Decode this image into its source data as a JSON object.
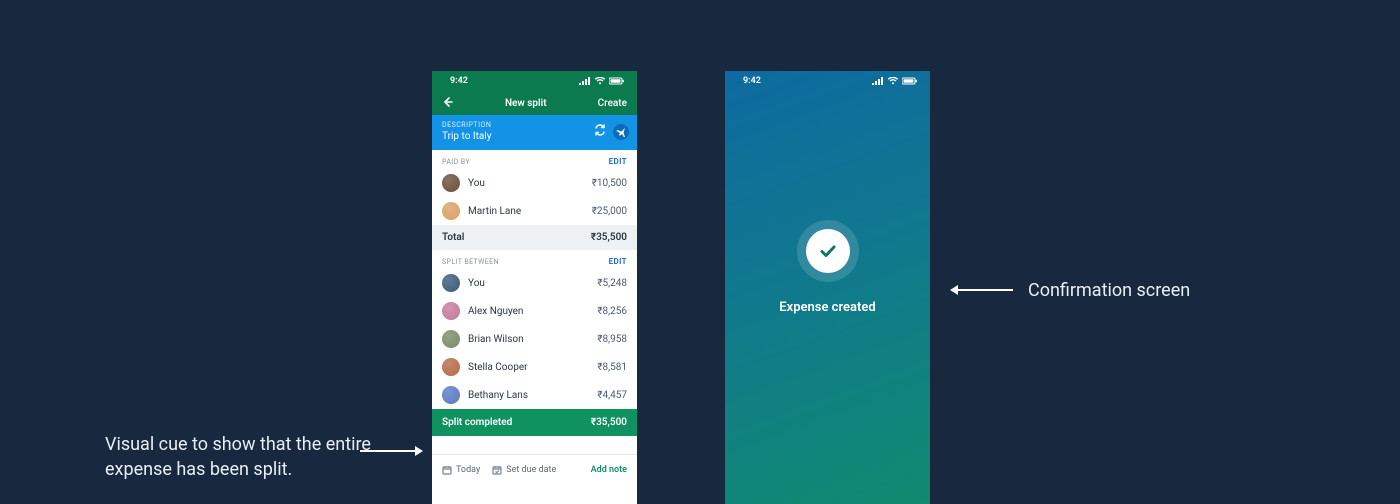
{
  "annotations": {
    "left": "Visual cue to show that the entire expense has been split.",
    "right": "Confirmation screen"
  },
  "status": {
    "time": "9:42"
  },
  "nav": {
    "title": "New split",
    "action": "Create"
  },
  "description": {
    "label": "DESCRIPTION",
    "value": "Trip to Italy"
  },
  "paid_by": {
    "label": "PAID BY",
    "edit": "EDIT",
    "rows": [
      {
        "name": "You",
        "amount": "₹10,500"
      },
      {
        "name": "Martin Lane",
        "amount": "₹25,000"
      }
    ],
    "total_label": "Total",
    "total_amount": "₹35,500"
  },
  "split_between": {
    "label": "SPLIT BETWEEN",
    "edit": "EDIT",
    "rows": [
      {
        "name": "You",
        "amount": "₹5,248"
      },
      {
        "name": "Alex Nguyen",
        "amount": "₹8,256"
      },
      {
        "name": "Brian Wilson",
        "amount": "₹8,958"
      },
      {
        "name": "Stella Cooper",
        "amount": "₹8,581"
      },
      {
        "name": "Bethany Lans",
        "amount": "₹4,457"
      }
    ]
  },
  "split_bar": {
    "label": "Split completed",
    "amount": "₹35,500"
  },
  "footer": {
    "today": "Today",
    "due": "Set due date",
    "note": "Add note"
  },
  "confirmation": {
    "text": "Expense created"
  },
  "avatar_colors": [
    "#6b4f3a",
    "#d9a066",
    "#3a5a7a",
    "#c47a9a",
    "#7a8a6a",
    "#b56a4a",
    "#5a7ac4"
  ]
}
